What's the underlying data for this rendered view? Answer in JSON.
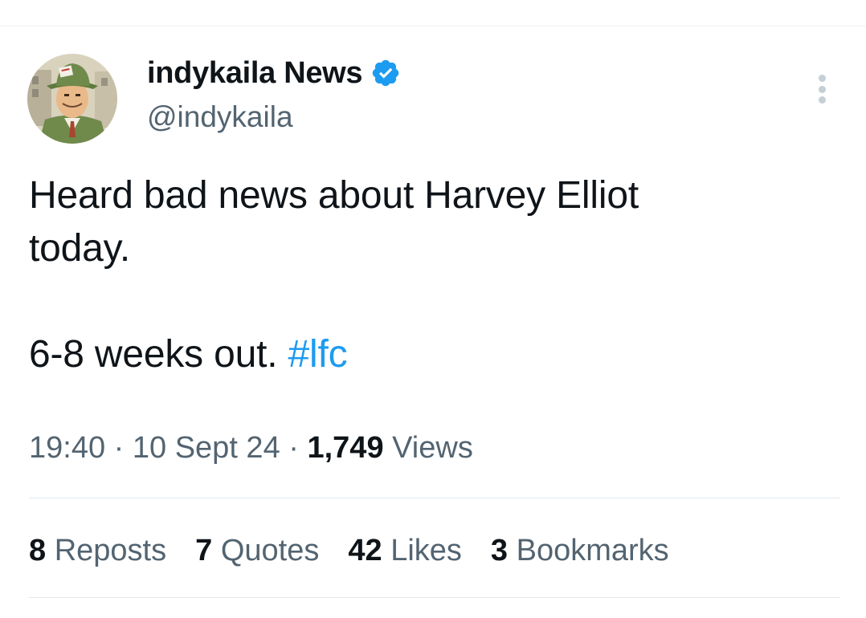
{
  "colors": {
    "text_primary": "#0f1419",
    "text_secondary": "#536471",
    "link": "#1d9bf0",
    "verified_badge": "#1d9bf0",
    "divider": "#e1e8ed"
  },
  "author": {
    "display_name": "indykaila News",
    "handle": "@indykaila",
    "verified": true,
    "avatar_icon": "cartoon-reporter-avatar"
  },
  "tweet": {
    "line1": "Heard bad news about Harvey Elliot",
    "line2": "today.",
    "line3": "6-8 weeks out.",
    "hashtag": "#lfc"
  },
  "meta": {
    "time": "19:40",
    "separator": "·",
    "date": "10 Sept 24",
    "views_count": "1,749",
    "views_label": "Views"
  },
  "stats": {
    "reposts_count": "8",
    "reposts_label": "Reposts",
    "quotes_count": "7",
    "quotes_label": "Quotes",
    "likes_count": "42",
    "likes_label": "Likes",
    "bookmarks_count": "3",
    "bookmarks_label": "Bookmarks"
  }
}
